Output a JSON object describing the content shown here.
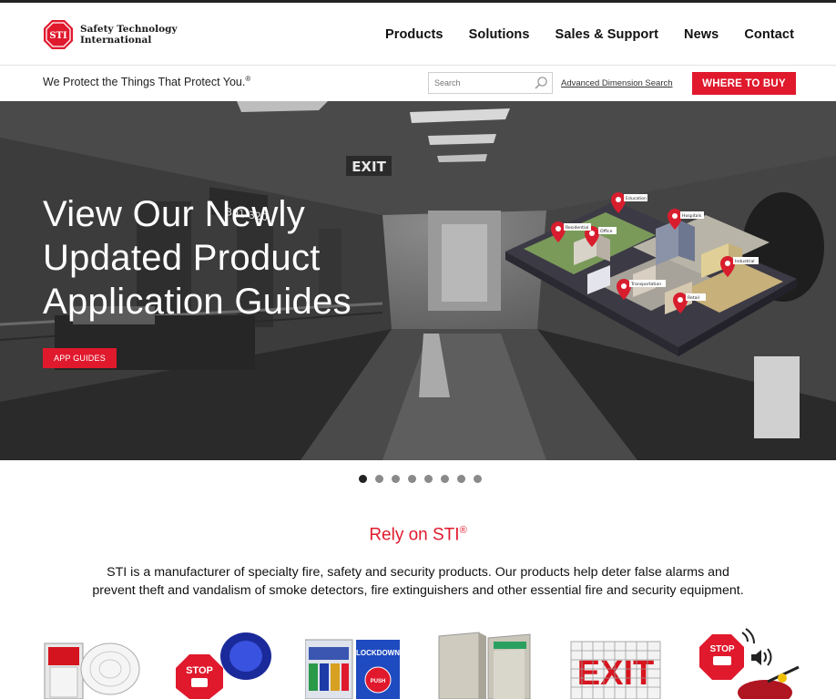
{
  "brand": {
    "logo_badge": "STI",
    "name_line1": "Safety Technology",
    "name_line2": "International"
  },
  "nav": [
    {
      "label": "Products"
    },
    {
      "label": "Solutions"
    },
    {
      "label": "Sales & Support"
    },
    {
      "label": "News"
    },
    {
      "label": "Contact"
    }
  ],
  "subbar": {
    "tagline": "We Protect the Things That Protect You.",
    "tagline_mark": "®",
    "search_placeholder": "Search",
    "advanced_search": "Advanced Dimension Search",
    "where_to_buy": "WHERE TO BUY"
  },
  "hero": {
    "title_line1": "View Our Newly",
    "title_line2": "Updated Product",
    "title_line3": "Application Guides",
    "button": "APP GUIDES",
    "map_labels": [
      "Education",
      "Hospitals",
      "Residential",
      "Office",
      "Industrial",
      "Transportation",
      "Retail"
    ],
    "scene_text": {
      "exit_sign": "EXIT",
      "room_sign": "301-320"
    }
  },
  "carousel": {
    "count": 8,
    "active": 0
  },
  "rely": {
    "title": "Rely on STI",
    "title_mark": "®",
    "line1": "STI is a manufacturer of specialty fire, safety and security products. Our products help deter false alarms and",
    "line2": "prevent theft and vandalism of smoke detectors, fire extinguishers and other essential fire and security equipment."
  },
  "products": [
    {
      "icon": "smoke-detector-cover-icon"
    },
    {
      "icon": "stop-alarm-beacon-icon",
      "label": "STOP"
    },
    {
      "icon": "lockdown-button-icon",
      "label": "LOCKDOWN",
      "sub": "PUSH"
    },
    {
      "icon": "extinguisher-cabinet-icon"
    },
    {
      "icon": "exit-sign-guard-icon",
      "label": "EXIT"
    },
    {
      "icon": "stop-alarm-speaker-icon",
      "label": "STOP"
    }
  ],
  "colors": {
    "accent": "#e0192d",
    "dark": "#222222"
  }
}
